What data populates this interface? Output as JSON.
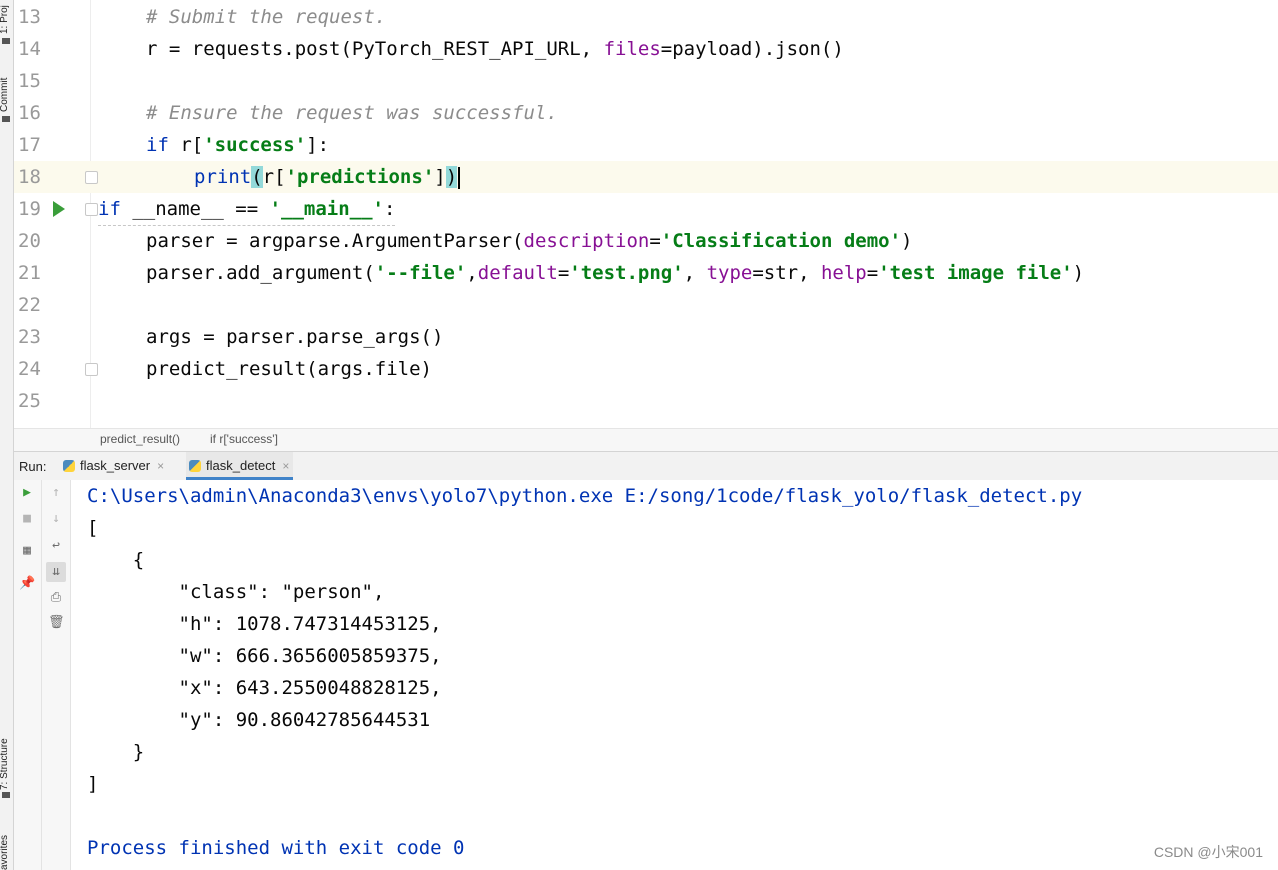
{
  "side_tabs": {
    "project": "1: Proj",
    "commit": "Commit",
    "structure": "7: Structure",
    "favorites": "avorites"
  },
  "editor": {
    "lines": [
      {
        "num": "13"
      },
      {
        "num": "14"
      },
      {
        "num": "15"
      },
      {
        "num": "16"
      },
      {
        "num": "17"
      },
      {
        "num": "18"
      },
      {
        "num": "19"
      },
      {
        "num": "20"
      },
      {
        "num": "21"
      },
      {
        "num": "22"
      },
      {
        "num": "23"
      },
      {
        "num": "24"
      },
      {
        "num": "25"
      }
    ],
    "tokens": {
      "l13_comment": "# Submit the request.",
      "l14_a": "r = requests.post(PyTorch_REST_API_URL, ",
      "l14_files": "files",
      "l14_b": "=payload).json()",
      "l16_comment": "# Ensure the request was successful.",
      "l17_if": "if",
      "l17_a": " r[",
      "l17_str": "'success'",
      "l17_b": "]:",
      "l18_print": "print",
      "l18_open": "(",
      "l18_a": "r[",
      "l18_str": "'predictions'",
      "l18_b": "]",
      "l18_close": ")",
      "l19_if": "if",
      "l19_a": " __name__ == ",
      "l19_str": "'__main__'",
      "l19_b": ":",
      "l20_a": "parser = argparse.ArgumentParser(",
      "l20_prm": "description",
      "l20_eq": "=",
      "l20_str": "'Classification demo'",
      "l20_b": ")",
      "l21_a": "parser.add_argument(",
      "l21_s1": "'--file'",
      "l21_c1": ",",
      "l21_p1": "default",
      "l21_e1": "=",
      "l21_s2": "'test.png'",
      "l21_c2": ", ",
      "l21_p2": "type",
      "l21_e2": "=str, ",
      "l21_p3": "help",
      "l21_e3": "=",
      "l21_s3": "'test image file'",
      "l21_b": ")",
      "l23": "args = parser.parse_args()",
      "l24": "predict_result(args.file)"
    }
  },
  "breadcrumb": {
    "item1": "predict_result()",
    "item2": "if r['success']"
  },
  "run": {
    "label": "Run:",
    "tabs": [
      {
        "label": "flask_server",
        "close": "×"
      },
      {
        "label": "flask_detect",
        "close": "×"
      }
    ]
  },
  "console": {
    "lines": [
      "C:\\Users\\admin\\Anaconda3\\envs\\yolo7\\python.exe E:/song/1code/flask_yolo/flask_detect.py",
      "[",
      "    {",
      "        \"class\": \"person\",",
      "        \"h\": 1078.747314453125,",
      "        \"w\": 666.3656005859375,",
      "        \"x\": 643.2550048828125,",
      "        \"y\": 90.86042785644531",
      "    }",
      "]",
      "",
      "Process finished with exit code 0"
    ]
  },
  "watermark": "CSDN @小宋001",
  "icons": [
    "run-icon",
    "stop-icon",
    "layout-icon",
    "pin-icon",
    "up-arrow-icon",
    "down-arrow-icon",
    "soft-wrap-icon",
    "scroll-to-end-icon",
    "print-icon",
    "trash-icon",
    "python-file-icon"
  ]
}
